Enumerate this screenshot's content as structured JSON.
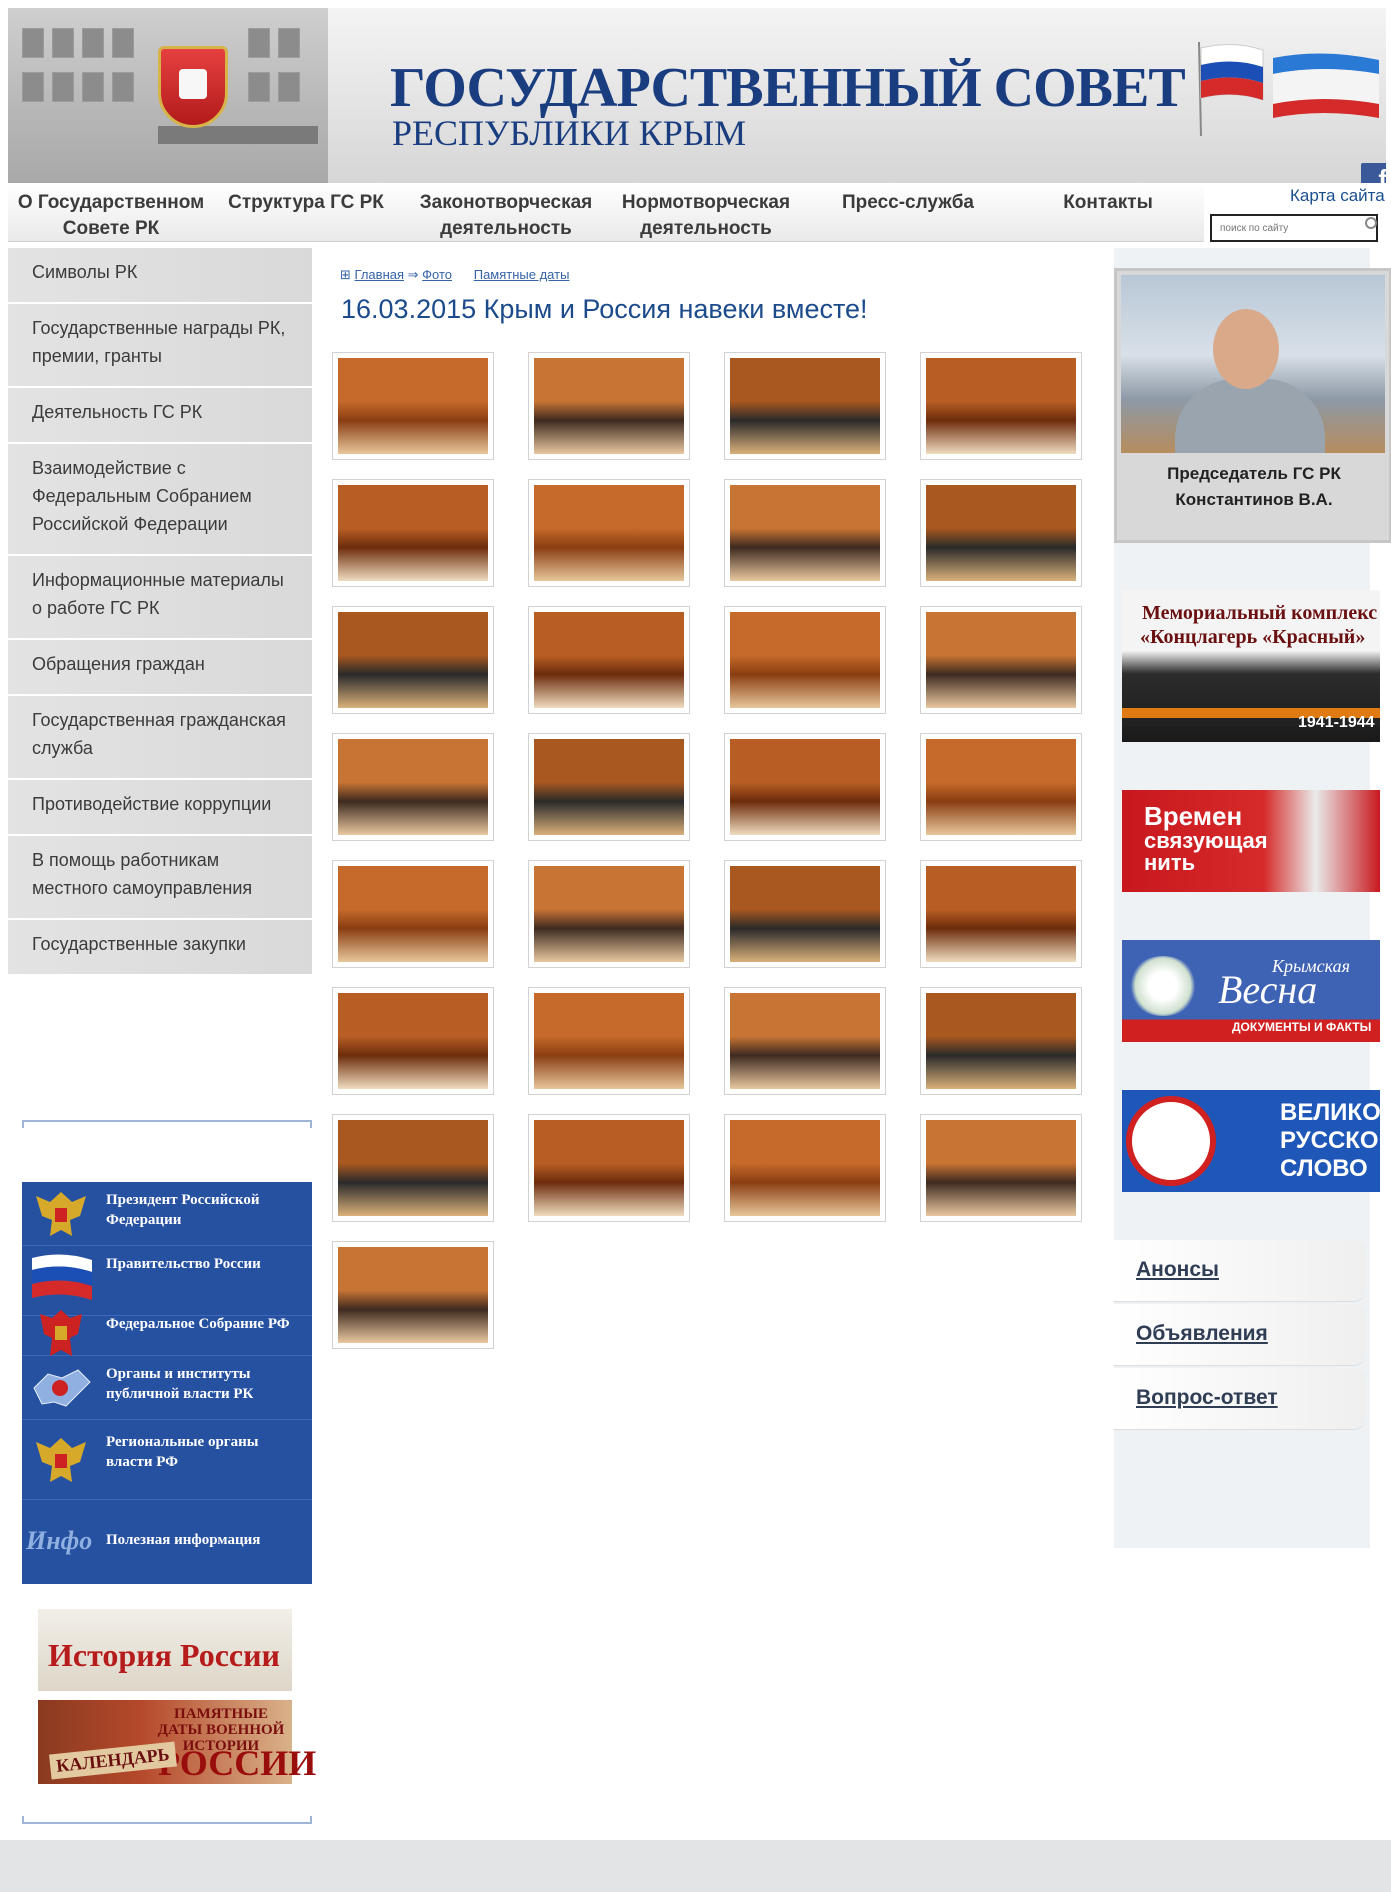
{
  "header": {
    "title": "ГОСУДАРСТВЕННЫЙ СОВЕТ",
    "subtitle": "РЕСПУБЛИКИ КРЫМ"
  },
  "topnav": {
    "items": [
      {
        "label": "О Государственном Совете РК"
      },
      {
        "label": "Структура ГС РК"
      },
      {
        "label": "Законотворческая деятельность"
      },
      {
        "label": "Нормотворческая деятельность"
      },
      {
        "label": "Пресс-служба"
      },
      {
        "label": "Контакты"
      }
    ],
    "sitemap": "Карта сайта",
    "search_placeholder": "поиск по сайту"
  },
  "sidebar": {
    "items": [
      {
        "label": "Символы РК"
      },
      {
        "label": "Государственные награды РК, премии, гранты"
      },
      {
        "label": "Деятельность ГС РК"
      },
      {
        "label": "Взаимодействие с Федеральным Собранием Российской Федерации"
      },
      {
        "label": "Информационные материалы о работе ГС РК"
      },
      {
        "label": "Обращения граждан"
      },
      {
        "label": "Государственная гражданская служба"
      },
      {
        "label": "Противодействие коррупции"
      },
      {
        "label": "В помощь работникам местного самоуправления"
      },
      {
        "label": "Государственные закупки"
      }
    ],
    "gov_links": [
      {
        "label": "Президент Российской Федерации",
        "icon": "eagle-icon"
      },
      {
        "label": "Правительство России",
        "icon": "russian-flag-icon"
      },
      {
        "label": "Федеральное Собрание РФ",
        "icon": "eagle-emblem-icon"
      },
      {
        "label": "Органы и институты публичной власти РК",
        "icon": "crimea-map-icon"
      },
      {
        "label": "Региональные органы власти РФ",
        "icon": "eagle-icon"
      },
      {
        "label": "Полезная информация",
        "icon": "info-icon"
      }
    ],
    "history_banner": "История России",
    "calendar_banner": {
      "label": "КАЛЕНДАРЬ",
      "title": "ПАМЯТНЫЕ ДАТЫ ВОЕННОЙ ИСТОРИИ",
      "big": "РОССИИ"
    }
  },
  "content": {
    "breadcrumb": [
      "Главная",
      "Фото",
      "Памятные даты"
    ],
    "title": "16.03.2015 Крым и Россия навеки вместе!",
    "photo_count": 29
  },
  "right": {
    "chairman_caption": "Председатель ГС РК Константинов В.А.",
    "banners": [
      {
        "line1": "Мемориальный комплекс",
        "line2": "«Концлагерь «Красный»",
        "years": "1941-1944"
      },
      {
        "line1": "Времен",
        "line2": "связующая",
        "line3": "нить"
      },
      {
        "line1": "Крымская",
        "line2": "Весна",
        "line3": "ДОКУМЕНТЫ И ФАКТЫ"
      },
      {
        "line1": "ВЕЛИКОЕ",
        "line2": "РУССКОЕ",
        "line3": "СЛОВО"
      }
    ],
    "links": [
      {
        "label": "Анонсы"
      },
      {
        "label": "Объявления"
      },
      {
        "label": "Вопрос-ответ"
      }
    ]
  },
  "colors": {
    "brand_blue": "#1a3d80",
    "link_blue": "#3563a8",
    "gov_panel": "#2651a0",
    "hall_wood": "#b85e24"
  }
}
